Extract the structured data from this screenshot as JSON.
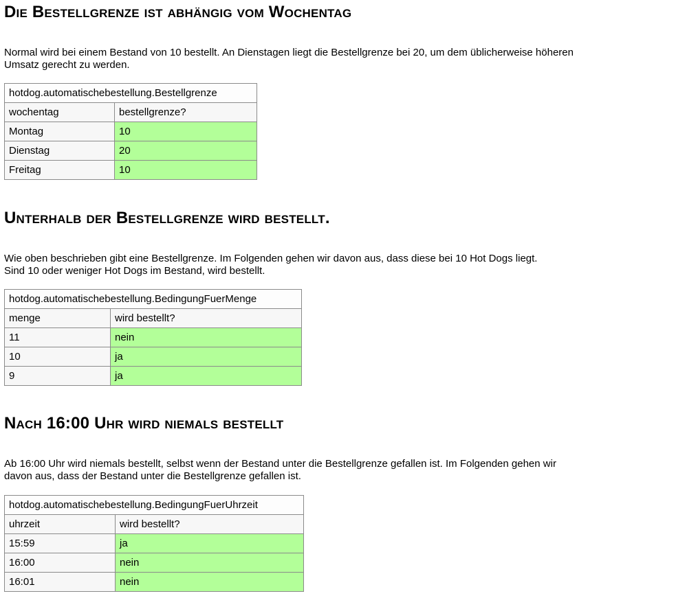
{
  "sections": [
    {
      "heading": "Die Bestellgrenze ist abhängig vom Wochentag",
      "text_line1": "Normal wird bei einem Bestand von 10 bestellt. An Dienstagen liegt die Bestellgrenze bei 20, um dem üblicherweise höheren",
      "text_line2": "Umsatz gerecht zu werden.",
      "table": {
        "title": "hotdog.automatischebestellung.Bestellgrenze",
        "headers": [
          "wochentag",
          "bestellgrenze?"
        ],
        "rows": [
          [
            "Montag",
            "10"
          ],
          [
            "Dienstag",
            "20"
          ],
          [
            "Freitag",
            "10"
          ]
        ]
      }
    },
    {
      "heading": "Unterhalb der Bestellgrenze wird bestellt.",
      "text_line1": "Wie oben beschrieben gibt eine Bestellgrenze. Im Folgenden gehen wir davon aus, dass diese bei 10 Hot Dogs liegt.",
      "text_line2": "Sind 10 oder weniger Hot Dogs im Bestand, wird bestellt.",
      "table": {
        "title": "hotdog.automatischebestellung.BedingungFuerMenge",
        "headers": [
          "menge",
          "wird bestellt?"
        ],
        "rows": [
          [
            "11",
            "nein"
          ],
          [
            "10",
            "ja"
          ],
          [
            "9",
            "ja"
          ]
        ]
      }
    },
    {
      "heading": "Nach 16:00 Uhr wird niemals bestellt",
      "text_line1": "Ab 16:00 Uhr wird niemals bestellt, selbst wenn der Bestand unter die Bestellgrenze gefallen ist. Im Folgenden gehen wir",
      "text_line2": "davon aus, dass der Bestand unter die Bestellgrenze gefallen ist.",
      "table": {
        "title": "hotdog.automatischebestellung.BedingungFuerUhrzeit",
        "headers": [
          "uhrzeit",
          "wird bestellt?"
        ],
        "rows": [
          [
            "15:59",
            "ja"
          ],
          [
            "16:00",
            "nein"
          ],
          [
            "16:01",
            "nein"
          ]
        ]
      }
    }
  ],
  "colors": {
    "pass": "#b3ff99",
    "plain": "#f7f7f7",
    "border": "#8a8a8a"
  }
}
